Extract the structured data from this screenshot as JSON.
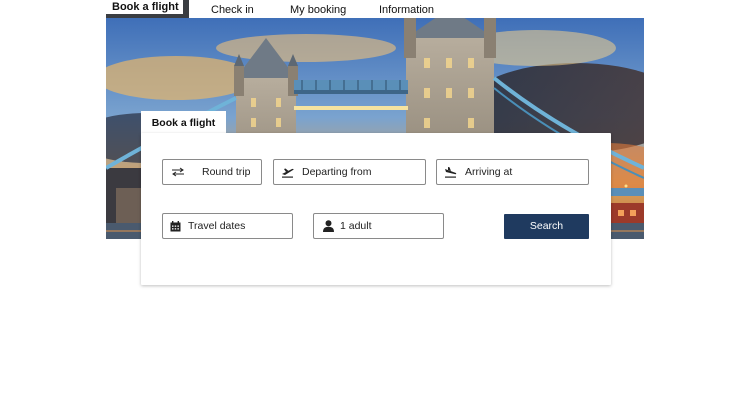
{
  "nav": {
    "items": [
      {
        "label": "Book a flight"
      },
      {
        "label": "Check in"
      },
      {
        "label": "My booking"
      },
      {
        "label": "Information"
      }
    ]
  },
  "hero": {
    "icon": "tower-bridge-photo"
  },
  "card": {
    "tab_label": "Book a flight",
    "trip_type": {
      "value": "Round trip",
      "icon": "swap-arrows-icon"
    },
    "departing": {
      "placeholder": "Departing from",
      "icon": "plane-takeoff-icon"
    },
    "arriving": {
      "placeholder": "Arriving at",
      "icon": "plane-landing-icon"
    },
    "dates": {
      "placeholder": "Travel dates",
      "icon": "calendar-icon"
    },
    "passengers": {
      "value": "1 adult",
      "icon": "person-icon"
    },
    "search_label": "Search"
  },
  "colors": {
    "accent": "#1f3a5f",
    "active_tab_bar": "#3a3d42"
  }
}
